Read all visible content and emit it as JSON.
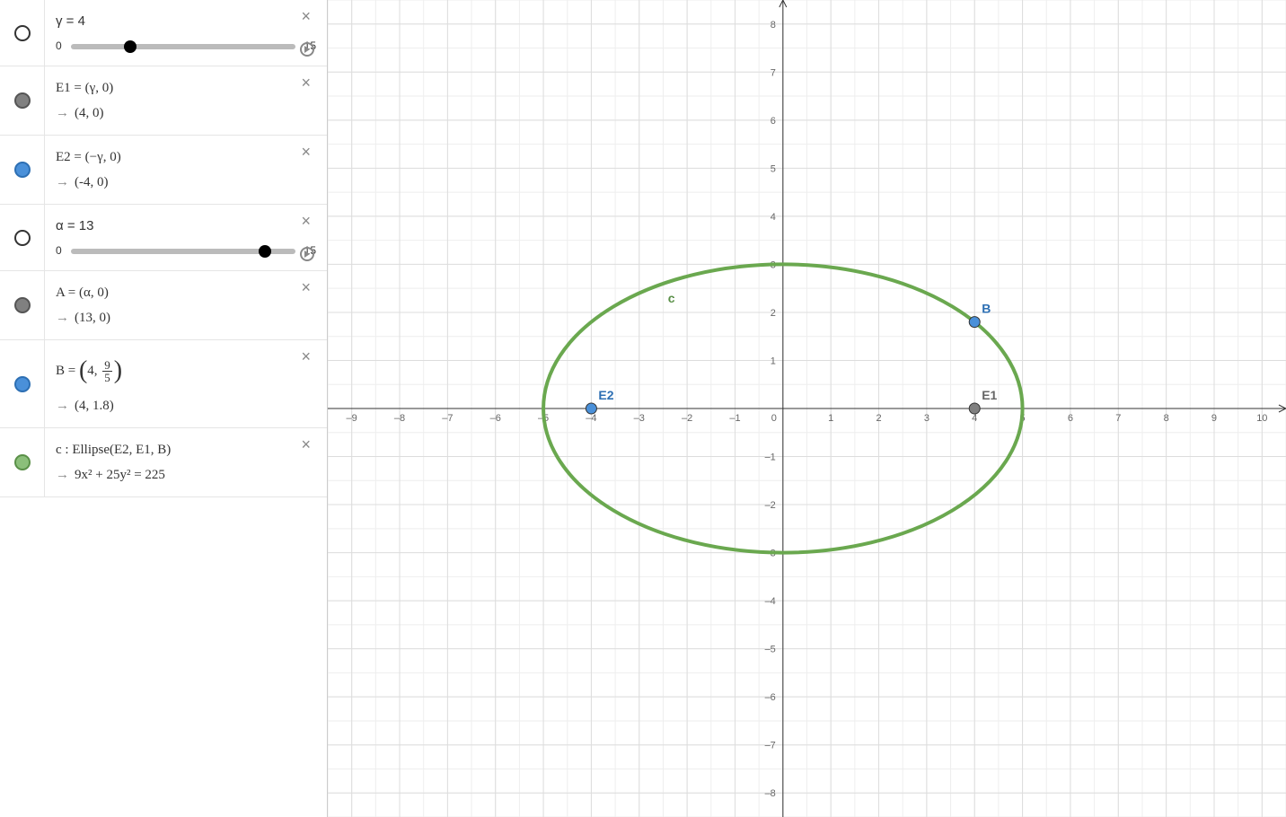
{
  "sidebar": {
    "gamma": {
      "label": "γ = 4",
      "min": "0",
      "max": "15",
      "pos": 26.7
    },
    "E1": {
      "def": "E1 = (γ, 0)",
      "val": "(4, 0)"
    },
    "E2": {
      "def": "E2 = (−γ, 0)",
      "val": "(-4, 0)"
    },
    "alpha": {
      "label": "α = 13",
      "min": "0",
      "max": "15",
      "pos": 86.7
    },
    "A": {
      "def": "A = (α, 0)",
      "val": "(13, 0)"
    },
    "B": {
      "def_prefix": "B = ",
      "def_x": "4",
      "def_num": "9",
      "def_den": "5",
      "val": "(4, 1.8)"
    },
    "c": {
      "def": "c : Ellipse(E2, E1, B)",
      "val": "9x² + 25y² = 225"
    }
  },
  "chart_data": {
    "type": "ellipse-plot",
    "title": "",
    "x_range": [
      -9.5,
      10.5
    ],
    "y_range": [
      -8.5,
      8.5
    ],
    "x_ticks": [
      -9,
      -8,
      -7,
      -6,
      -5,
      -4,
      -3,
      -2,
      -1,
      0,
      1,
      2,
      3,
      4,
      5,
      6,
      7,
      8,
      9,
      10
    ],
    "y_ticks": [
      -8,
      -7,
      -6,
      -5,
      -4,
      -3,
      -2,
      -1,
      1,
      2,
      3,
      4,
      5,
      6,
      7,
      8
    ],
    "points": [
      {
        "name": "E1",
        "x": 4,
        "y": 0,
        "color": "#808080",
        "label_color": "#666",
        "label_dx": 8,
        "label_dy": -10
      },
      {
        "name": "E2",
        "x": -4,
        "y": 0,
        "color": "#4a90d9",
        "label_color": "#2d6fb3",
        "label_dx": 8,
        "label_dy": -10
      },
      {
        "name": "B",
        "x": 4,
        "y": 1.8,
        "color": "#4a90d9",
        "label_color": "#2d6fb3",
        "label_dx": 8,
        "label_dy": -10
      }
    ],
    "curves": [
      {
        "name": "c",
        "type": "ellipse",
        "cx": 0,
        "cy": 0,
        "rx": 5,
        "ry": 3,
        "color": "#6aa84f",
        "label_x": -2.4,
        "label_y": 2.2
      }
    ]
  }
}
